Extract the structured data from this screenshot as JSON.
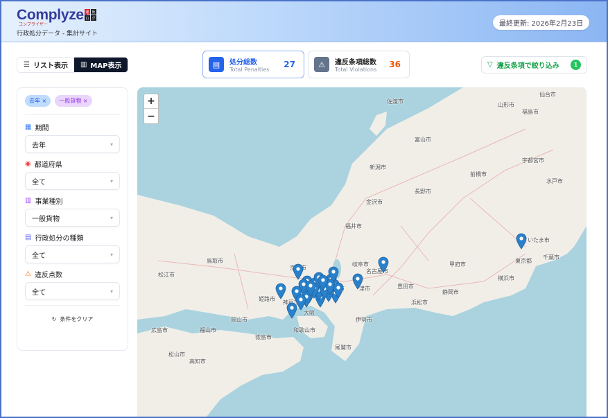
{
  "header": {
    "logo": "Complyzer",
    "logo_sub": "コンプライザー",
    "logo_badge": [
      "違",
      "反",
      "ロ",
      "グ"
    ],
    "tagline": "行政処分データ - 集計サイト",
    "last_updated": "最終更新: 2026年2月23日"
  },
  "view_toggle": {
    "list": "リスト表示",
    "map": "MAP表示",
    "active": "map"
  },
  "stats": [
    {
      "label": "処分総数",
      "sub": "Total Penalties",
      "value": "27",
      "color": "#2563eb",
      "icon": "document-icon"
    },
    {
      "label": "違反条項総数",
      "sub": "Total Violations",
      "value": "36",
      "color": "#ea580c",
      "icon": "warning-icon"
    }
  ],
  "filter_button": {
    "label": "違反条項で絞り込み",
    "count": "1"
  },
  "sidebar": {
    "chips": [
      {
        "label": "去年",
        "color": "blue"
      },
      {
        "label": "一般貨物",
        "color": "purple"
      }
    ],
    "filters": [
      {
        "label": "期間",
        "value": "去年",
        "icon": "calendar-icon",
        "color": "#3b82f6"
      },
      {
        "label": "都道府県",
        "value": "全て",
        "icon": "map-pin-icon",
        "color": "#ef4444"
      },
      {
        "label": "事業種別",
        "value": "一般貨物",
        "icon": "building-icon",
        "color": "#a855f7"
      },
      {
        "label": "行政処分の種類",
        "value": "全て",
        "icon": "file-icon",
        "color": "#6366f1"
      },
      {
        "label": "違反点数",
        "value": "全て",
        "icon": "warning-icon",
        "color": "#f97316"
      }
    ],
    "clear": "条件をクリア"
  },
  "map": {
    "zoom_in": "+",
    "zoom_out": "−",
    "labels": [
      "新潟市",
      "金沢市",
      "福井市",
      "長野市",
      "前橋市",
      "福島市",
      "仙台市",
      "山形市",
      "宇都宮市",
      "水戸市",
      "さいたま市",
      "東京都",
      "千葉市",
      "横浜市",
      "甲府市",
      "静岡市",
      "浜松市",
      "名古屋市",
      "豊田市",
      "岐阜市",
      "津市",
      "大津市",
      "京都市",
      "大阪",
      "和歌山市",
      "神戸市",
      "姫路市",
      "岡山市",
      "鳥取市",
      "広島市",
      "松山市",
      "高知市",
      "徳島市",
      "福山市",
      "松江市",
      "富山市",
      "佐渡市",
      "伊勢市",
      "尾鷲市"
    ]
  }
}
